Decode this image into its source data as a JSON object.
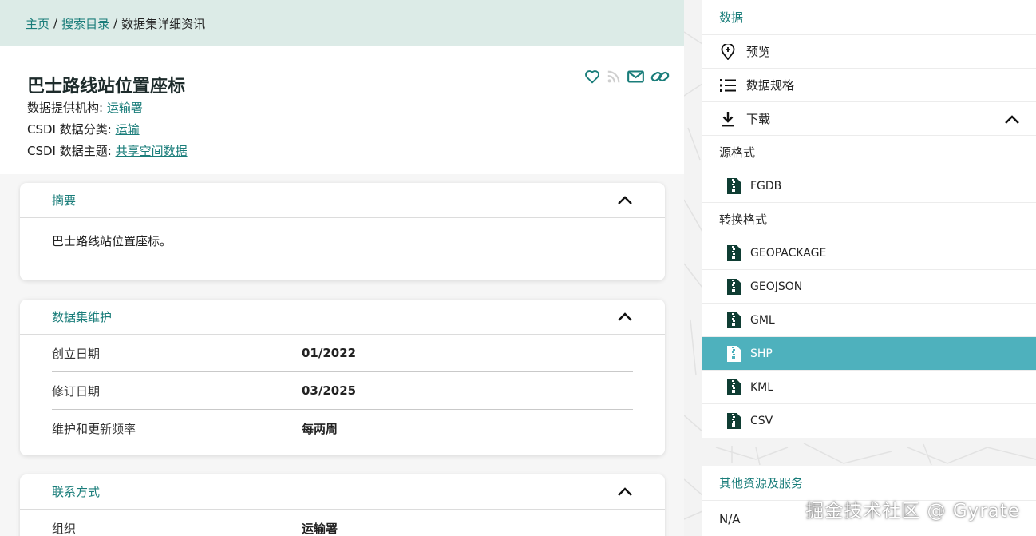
{
  "breadcrumb": {
    "home": "主页",
    "catalog": "搜索目录",
    "current": "数据集详细资讯",
    "separator": "/"
  },
  "dataset": {
    "title": "巴士路线站位置座标",
    "provider_label": "数据提供机构: ",
    "provider_value": "运输署",
    "category_label": "CSDI 数据分类: ",
    "category_value": "运输",
    "theme_label": "CSDI 数据主题: ",
    "theme_value": "共享空间数据"
  },
  "actions": [
    "heart-icon",
    "rss-icon",
    "mail-icon",
    "link-icon"
  ],
  "summary": {
    "title": "摘要",
    "text": "巴士路线站位置座标。"
  },
  "maintenance": {
    "title": "数据集维护",
    "rows": [
      {
        "key": "创立日期",
        "value": "01/2022"
      },
      {
        "key": "修订日期",
        "value": "03/2025"
      },
      {
        "key": "维护和更新频率",
        "value": "每两周"
      }
    ]
  },
  "contact": {
    "title": "联系方式",
    "rows": [
      {
        "key": "组织",
        "value": "运输署"
      }
    ]
  },
  "sidebar": {
    "header": "数据",
    "items": [
      {
        "label": "预览",
        "icon": "map-pin-icon"
      },
      {
        "label": "数据规格",
        "icon": "list-icon"
      },
      {
        "label": "下载",
        "icon": "download-icon"
      }
    ],
    "source_format_label": "源格式",
    "source_formats": [
      "FGDB"
    ],
    "converted_format_label": "转换格式",
    "converted_formats": [
      "GEOPACKAGE",
      "GEOJSON",
      "GML",
      "SHP",
      "KML",
      "CSV"
    ],
    "selected_format": "SHP"
  },
  "other_resources": {
    "title": "其他资源及服务",
    "value": "N/A"
  },
  "watermark": "掘金技术社区 @ Gyrate",
  "colors": {
    "accent": "#1a7d7a",
    "breadcrumb_bg": "#dcebe7",
    "selected_bg": "#4eb1bd",
    "file_icon": "#0f3d33"
  }
}
